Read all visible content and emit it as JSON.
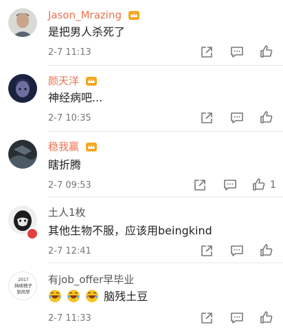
{
  "comments": [
    {
      "username": "Jason_Mrazing",
      "text": "是把男人杀死了",
      "time": "2-7 11:13",
      "like_count": ""
    },
    {
      "username": "颜天洋",
      "text": "神经病吧...",
      "time": "2-7 10:35",
      "like_count": ""
    },
    {
      "username": "稳我赢",
      "text": "瞎折腾",
      "time": "2-7 09:53",
      "like_count": "1"
    },
    {
      "username": "土人1枚",
      "text": "其他生物不服，应该用beingkind",
      "time": "2-7 12:41",
      "like_count": ""
    },
    {
      "username": "有job_offer早毕业",
      "text": "脑残土豆",
      "time": "2-7 11:33",
      "like_count": "",
      "avatar_text": [
        "2017",
        "持续稍子",
        "到尚早"
      ]
    }
  ],
  "colors": {
    "vip_name": "#eb7350",
    "normal_name": "#555555",
    "icon_gray": "#777777"
  },
  "icons": [
    "vip-crown-icon",
    "share-icon",
    "comment-icon",
    "like-icon",
    "laugh-emoji-icon"
  ]
}
